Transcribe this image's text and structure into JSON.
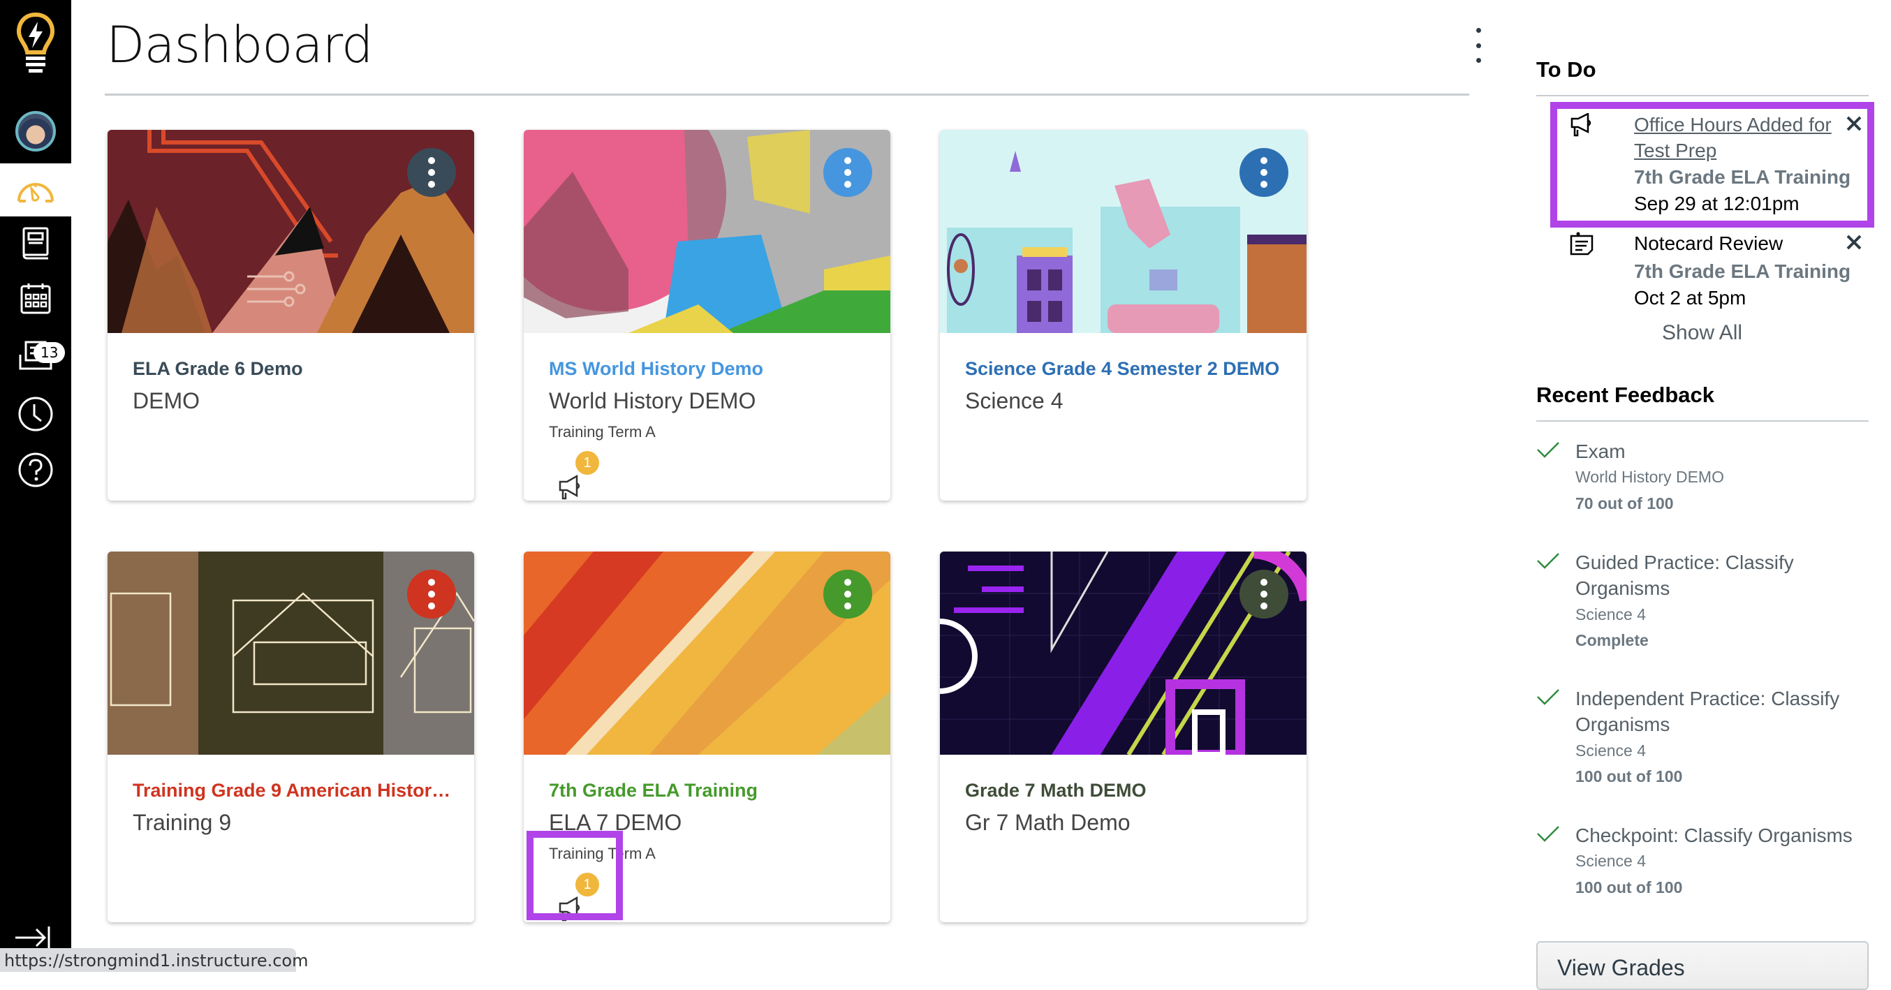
{
  "sidebar": {
    "items": [
      {
        "name": "logo",
        "label": ""
      },
      {
        "name": "account",
        "label": ""
      },
      {
        "name": "dashboard",
        "label": "",
        "active": true
      },
      {
        "name": "courses",
        "label": ""
      },
      {
        "name": "calendar",
        "label": ""
      },
      {
        "name": "inbox",
        "label": "",
        "badge": "13"
      },
      {
        "name": "history",
        "label": ""
      },
      {
        "name": "help",
        "label": ""
      }
    ],
    "inbox_badge": "13"
  },
  "header": {
    "title": "Dashboard"
  },
  "cards": [
    {
      "title": "ELA Grade 6 Demo",
      "subtitle": "DEMO",
      "term": "",
      "color": "#394B58",
      "title_color": "#394B58",
      "announcements": null
    },
    {
      "title": "MS World History Demo",
      "subtitle": "World History DEMO",
      "term": "Training Term A",
      "color": "#4596de",
      "title_color": "#4596de",
      "announcements": "1"
    },
    {
      "title": "Science Grade 4 Semester 2 DEMO",
      "subtitle": "Science 4",
      "term": "",
      "color": "#2d6fb3",
      "title_color": "#2d6fb3",
      "announcements": null
    },
    {
      "title": "Training Grade 9 American History...",
      "subtitle": "Training 9",
      "term": "",
      "color": "#cf3420",
      "title_color": "#cf3420",
      "announcements": null
    },
    {
      "title": "7th Grade ELA Training",
      "subtitle": "ELA 7 DEMO",
      "term": "Training Term A",
      "color": "#459a2b",
      "title_color": "#459a2b",
      "announcements": "1"
    },
    {
      "title": "Grade 7 Math DEMO",
      "subtitle": "Gr 7 Math Demo",
      "term": "",
      "color": "#3f4d38",
      "title_color": "#3f4d38",
      "announcements": null
    }
  ],
  "todo": {
    "heading": "To Do",
    "items": [
      {
        "icon": "announcement-icon",
        "title": "Office Hours Added for Test Prep",
        "course": "7th Grade ELA Training",
        "date": "Sep 29 at 12:01pm",
        "link": true
      },
      {
        "icon": "assignment-icon",
        "title": "Notecard Review",
        "course": "7th Grade ELA Training",
        "date": "Oct 2 at 5pm",
        "link": false
      }
    ],
    "show_all": "Show All"
  },
  "feedback": {
    "heading": "Recent Feedback",
    "items": [
      {
        "title": "Exam",
        "course": "World History DEMO",
        "score": "70 out of 100"
      },
      {
        "title": "Guided Practice: Classify Organisms",
        "course": "Science 4",
        "score": "Complete"
      },
      {
        "title": "Independent Practice: Classify Organisms",
        "course": "Science 4",
        "score": "100 out of 100"
      },
      {
        "title": "Checkpoint: Classify Organisms",
        "course": "Science 4",
        "score": "100 out of 100"
      }
    ],
    "view_grades": "View Grades"
  },
  "status_bar": {
    "url": "https://strongmind1.instructure.com"
  },
  "accent": {
    "highlight": "#b044e8",
    "brand_yellow": "#f0b73c"
  }
}
